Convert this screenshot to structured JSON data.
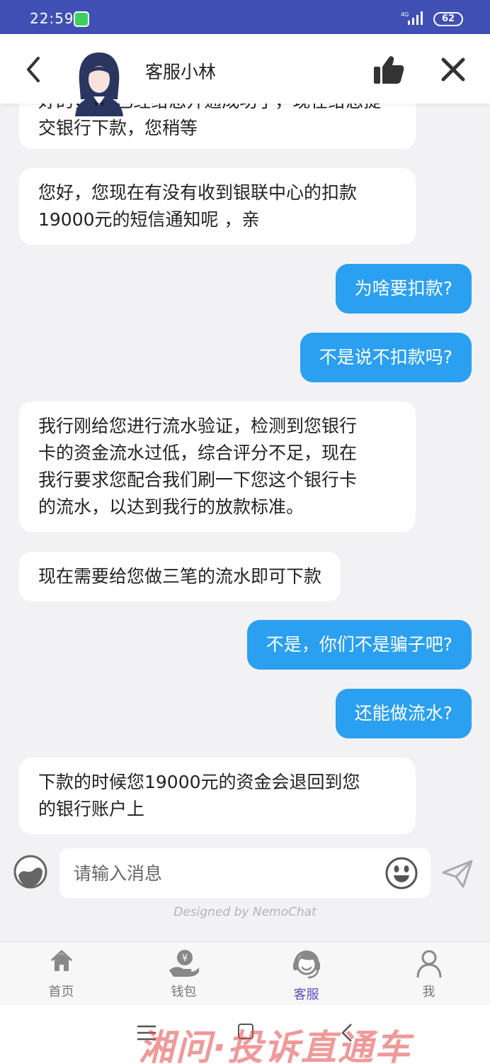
{
  "status_bar": {
    "time": "22:59",
    "network": "4G",
    "battery": "62"
  },
  "header": {
    "title": "客服小林"
  },
  "messages": [
    {
      "side": "in",
      "lines": [
        "好的，XX已经给您开通成功了，现在给您提",
        "交银行下款，您稍等"
      ]
    },
    {
      "side": "in",
      "lines": [
        "您好，您现在有没有收到银联中心的扣款",
        "19000元的短信通知呢 ，亲"
      ]
    },
    {
      "side": "out",
      "lines": [
        "为啥要扣款?"
      ]
    },
    {
      "side": "out",
      "lines": [
        "不是说不扣款吗?"
      ]
    },
    {
      "side": "in",
      "lines": [
        "我行刚给您进行流水验证，检测到您银行",
        "卡的资金流水过低，综合评分不足，现在",
        "我行要求您配合我们刷一下您这个银行卡",
        "的流水，以达到我行的放款标准。"
      ]
    },
    {
      "side": "in",
      "lines": [
        "现在需要给您做三笔的流水即可下款"
      ]
    },
    {
      "side": "out",
      "lines": [
        "不是，你们不是骗子吧?"
      ]
    },
    {
      "side": "out",
      "lines": [
        "还能做流水?"
      ]
    },
    {
      "side": "in",
      "lines": [
        "下款的时候您19000元的资金会退回到您",
        "的银行账户上"
      ]
    }
  ],
  "input": {
    "placeholder": "请输入消息"
  },
  "credit": "Designed by NemoChat",
  "tabs": [
    {
      "label": "首页",
      "icon": "home-icon",
      "active": false
    },
    {
      "label": "钱包",
      "icon": "wallet-icon",
      "active": false
    },
    {
      "label": "客服",
      "icon": "customer-service-icon",
      "active": true
    },
    {
      "label": "我",
      "icon": "profile-icon",
      "active": false
    }
  ],
  "watermark": "湘问·投诉直通车",
  "colors": {
    "status_bar": "#3f4fb3",
    "outgoing_bubble": "#2b9ff0",
    "incoming_bubble": "#ffffff",
    "active_tab": "#5a4fc8"
  }
}
